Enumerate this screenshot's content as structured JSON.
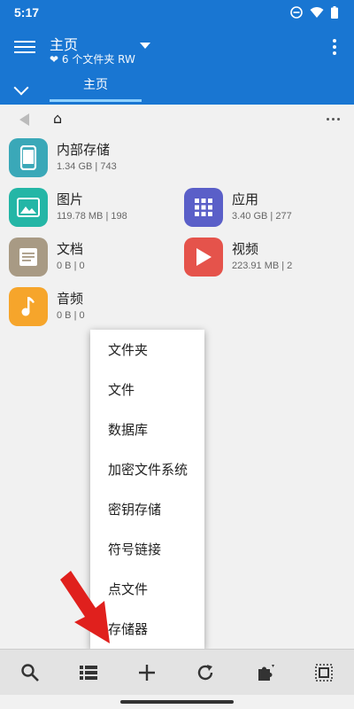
{
  "status_bar": {
    "time": "5:17"
  },
  "app_bar": {
    "title": "主页",
    "subtitle": "6 个文件夹 RW",
    "tab": "主页"
  },
  "path_bar": {
    "home_glyph": "⌂"
  },
  "tiles": [
    {
      "name": "内部存储",
      "meta": "1.34 GB | 743",
      "color": "#3aa8b8",
      "icon": "phone-icon"
    },
    {
      "name": "图片",
      "meta": "119.78 MB | 198",
      "color": "#24b6a6",
      "icon": "image-icon"
    },
    {
      "name": "应用",
      "meta": "3.40 GB | 277",
      "color": "#5a5fc8",
      "icon": "apps-grid-icon"
    },
    {
      "name": "文档",
      "meta": "0 B | 0",
      "color": "#a89a84",
      "icon": "document-icon"
    },
    {
      "name": "视频",
      "meta": "223.91 MB | 2",
      "color": "#e5534b",
      "icon": "play-icon"
    },
    {
      "name": "音频",
      "meta": "0 B | 0",
      "color": "#f6a52b",
      "icon": "music-note-icon"
    }
  ],
  "context_menu": {
    "items": [
      "文件夹",
      "文件",
      "数据库",
      "加密文件系统",
      "密钥存储",
      "符号链接",
      "点文件",
      "存储器"
    ]
  },
  "bottom_bar": {
    "icons": [
      "search-icon",
      "list-view-icon",
      "add-icon",
      "refresh-icon",
      "plugin-icon",
      "select-all-icon"
    ]
  },
  "colors": {
    "primary": "#1976d2",
    "accent_underline": "#8fd0ff",
    "arrow": "#e0201d"
  }
}
